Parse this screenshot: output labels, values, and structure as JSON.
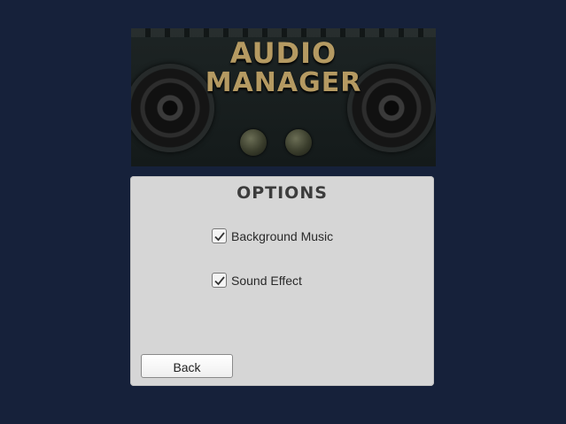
{
  "banner": {
    "logo_line1": "AUDIO",
    "logo_line2": "MANAGER"
  },
  "panel": {
    "title": "OPTIONS",
    "options": [
      {
        "label": "Background Music",
        "checked": true
      },
      {
        "label": "Sound Effect",
        "checked": true
      }
    ],
    "back_label": "Back"
  },
  "colors": {
    "background": "#16213a",
    "panel": "#d6d6d6",
    "logo": "#b59a62"
  }
}
